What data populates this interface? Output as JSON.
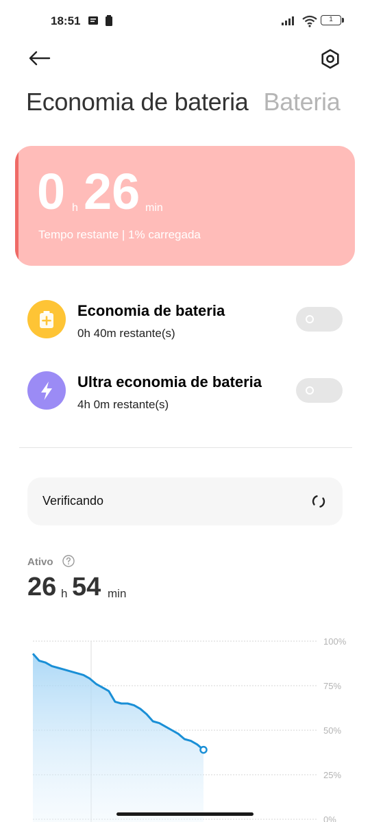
{
  "status_bar": {
    "time": "18:51",
    "battery_level": "1"
  },
  "header": {
    "back_icon": "arrow-left-icon",
    "settings_icon": "gear-icon"
  },
  "tabs": [
    {
      "label": "Economia de bateria",
      "active": true
    },
    {
      "label": "Bateria",
      "active": false
    }
  ],
  "battery_card": {
    "hours": "0",
    "hours_unit": "h",
    "minutes": "26",
    "minutes_unit": "min",
    "subtitle": "Tempo restante | 1% carregada",
    "background_color": "#ffbcb9",
    "accent_color": "#ef6b67"
  },
  "modes": [
    {
      "title": "Economia de bateria",
      "subtitle": "0h 40m restante(s)",
      "icon": "battery-plus-icon",
      "icon_color": "#fec435",
      "enabled": false
    },
    {
      "title": "Ultra economia de bateria",
      "subtitle": "4h 0m restante(s)",
      "icon": "lightning-icon",
      "icon_color": "#9b8bf5",
      "enabled": false
    }
  ],
  "check": {
    "label": "Verificando",
    "icon": "refresh-icon"
  },
  "usage": {
    "label": "Ativo",
    "help_icon": "help-icon",
    "hours": "26",
    "hours_unit": "h",
    "minutes": "54",
    "minutes_unit": "min"
  },
  "chart_data": {
    "type": "area",
    "title": "",
    "xlabel": "",
    "ylabel": "",
    "ylim": [
      0,
      100
    ],
    "y_ticks": [
      "100%",
      "75%",
      "50%",
      "25%",
      "0%"
    ],
    "grid": true,
    "line_color": "#1a8fd6",
    "series": [
      {
        "values": [
          93,
          89,
          88,
          86,
          85,
          84,
          83,
          82,
          81,
          79,
          76,
          74,
          72,
          66,
          65,
          65,
          64,
          62,
          59,
          55,
          54,
          52,
          50,
          48,
          45,
          44,
          42,
          39
        ]
      }
    ]
  }
}
